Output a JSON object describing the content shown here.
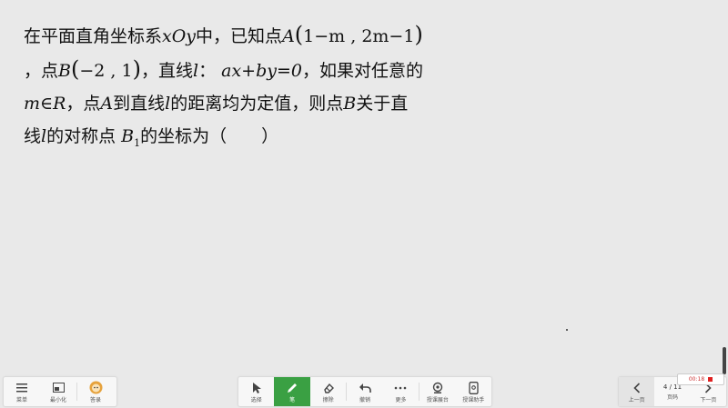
{
  "question": {
    "seg1": "在平面直角坐标系",
    "xOy": "xOy",
    "seg2": "中，已知点",
    "pointA": "A",
    "A_coords": [
      "1−m",
      "2m−1"
    ],
    "seg3": "，点",
    "pointB": "B",
    "B_coords": [
      "−2",
      "1"
    ],
    "seg4": "，直线",
    "line_l": "l",
    "colon": "：",
    "equation": "ax+by=0",
    "seg5": "，如果对任意的",
    "m_in_R": "m∈R",
    "seg6": "，点",
    "seg7": "到直线",
    "seg8": "的距离均为定值，则点",
    "seg9": "关于直",
    "seg10": "线",
    "seg11": "的对称点",
    "B1": "B",
    "B1_sub": "1",
    "seg12": "的坐标为（　　）"
  },
  "toolbar_left": [
    {
      "label": "菜单",
      "icon": "menu-icon"
    },
    {
      "label": "最小化",
      "icon": "minimize-icon"
    },
    {
      "label": "答录",
      "icon": "avatar-icon"
    }
  ],
  "toolbar_center": [
    {
      "label": "选择",
      "icon": "cursor-icon"
    },
    {
      "label": "笔",
      "icon": "pen-icon"
    },
    {
      "label": "擦除",
      "icon": "eraser-icon"
    },
    {
      "label": "撤销",
      "icon": "undo-icon"
    },
    {
      "label": "更多",
      "icon": "more-icon"
    },
    {
      "label": "授课展台",
      "icon": "camera-icon"
    },
    {
      "label": "授课助手",
      "icon": "phone-icon"
    }
  ],
  "toolbar_right": {
    "prev_label": "上一页",
    "page": "4 / 11",
    "page_label": "页码",
    "next_label": "下一页"
  },
  "recording": {
    "time": "00:18"
  },
  "colors": {
    "background": "#e9e9e9",
    "active_tool": "#3aa043",
    "record": "#e02020"
  }
}
